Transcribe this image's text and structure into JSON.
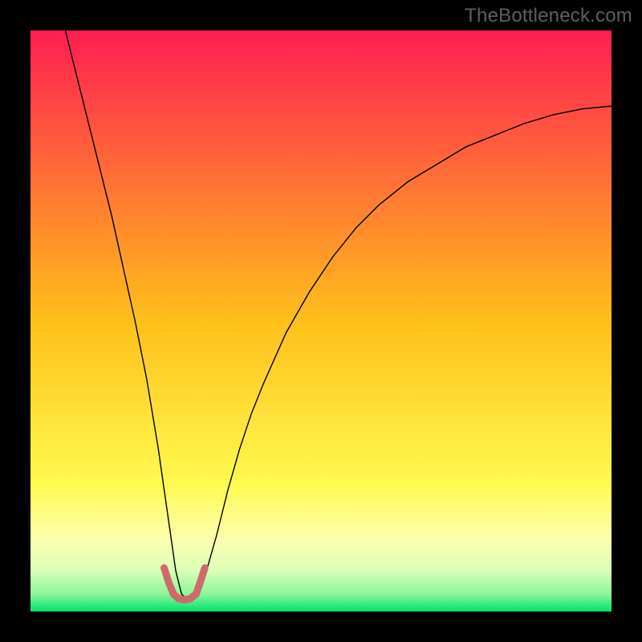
{
  "watermark": "TheBottleneck.com",
  "chart_data": {
    "type": "line",
    "title": "",
    "xlabel": "",
    "ylabel": "",
    "xlim": [
      0,
      100
    ],
    "ylim": [
      0,
      100
    ],
    "grid": false,
    "legend": false,
    "background_gradient": {
      "stops": [
        {
          "pos": 0.0,
          "color": "#ff1e52"
        },
        {
          "pos": 0.5,
          "color": "#ffbf1a"
        },
        {
          "pos": 0.78,
          "color": "#fffa4f"
        },
        {
          "pos": 0.88,
          "color": "#fcffb0"
        },
        {
          "pos": 0.93,
          "color": "#d9ffb8"
        },
        {
          "pos": 0.97,
          "color": "#8cf59a"
        },
        {
          "pos": 1.0,
          "color": "#00e36e"
        }
      ]
    },
    "series": [
      {
        "name": "bottleneck-curve",
        "stroke": "#000000",
        "stroke_width": 1.4,
        "x": [
          6,
          8,
          10,
          12,
          14,
          16,
          18,
          20,
          22,
          23,
          24,
          25,
          26,
          27,
          28,
          29,
          30,
          32,
          34,
          36,
          38,
          40,
          44,
          48,
          52,
          56,
          60,
          65,
          70,
          75,
          80,
          85,
          90,
          95,
          100
        ],
        "y": [
          100,
          92,
          84,
          76,
          68,
          59,
          50,
          40,
          28,
          21,
          14,
          7,
          3,
          2,
          2,
          3,
          6,
          13,
          21,
          28,
          34,
          39,
          48,
          55,
          61,
          66,
          70,
          74,
          77,
          80,
          82,
          84,
          85.5,
          86.5,
          87
        ]
      },
      {
        "name": "bottom-marker",
        "stroke": "#cf6a6a",
        "stroke_width": 9,
        "linecap": "round",
        "x": [
          23.0,
          23.8,
          24.6,
          25.5,
          26.5,
          27.5,
          28.5,
          29.2,
          30.0
        ],
        "y": [
          7.5,
          5.0,
          3.0,
          2.2,
          2.0,
          2.2,
          3.0,
          5.0,
          7.5
        ]
      }
    ]
  }
}
